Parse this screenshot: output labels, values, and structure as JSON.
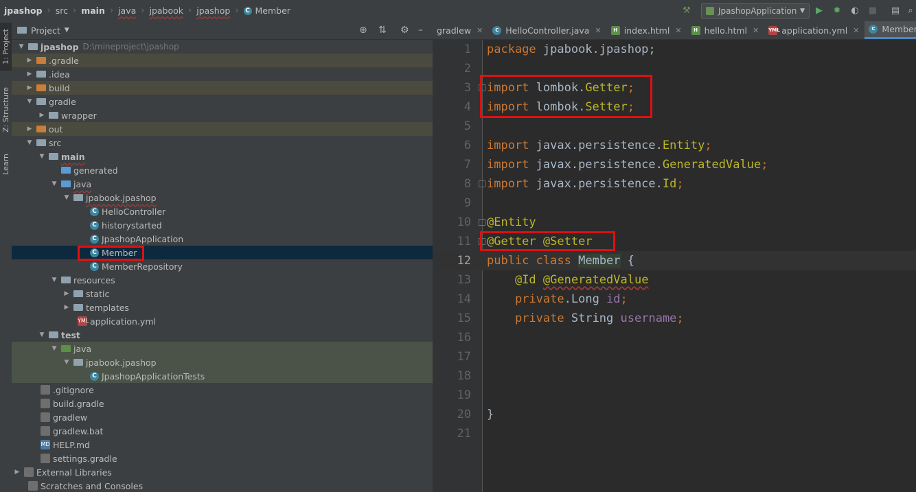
{
  "breadcrumbs": [
    {
      "label": "jpashop"
    },
    {
      "label": "src"
    },
    {
      "label": "main"
    },
    {
      "label": "java"
    },
    {
      "label": "jpabook"
    },
    {
      "label": "jpashop"
    },
    {
      "label": "Member"
    }
  ],
  "run_config": {
    "label": "JpashopApplication"
  },
  "left_tabs": {
    "project": "1: Project",
    "structure": "Z: Structure",
    "learn": "Learn"
  },
  "project_panel": {
    "title": "Project"
  },
  "tree": [
    {
      "label": "jpashop",
      "path": "D:\\mineproject\\jpashop"
    },
    {
      "label": ".gradle"
    },
    {
      "label": ".idea"
    },
    {
      "label": "build"
    },
    {
      "label": "gradle"
    },
    {
      "label": "wrapper"
    },
    {
      "label": "out"
    },
    {
      "label": "src"
    },
    {
      "label": "main"
    },
    {
      "label": "generated"
    },
    {
      "label": "java"
    },
    {
      "label": "jpabook.jpashop"
    },
    {
      "label": "HelloController"
    },
    {
      "label": "historystarted"
    },
    {
      "label": "JpashopApplication"
    },
    {
      "label": "Member"
    },
    {
      "label": "MemberRepository"
    },
    {
      "label": "resources"
    },
    {
      "label": "static"
    },
    {
      "label": "templates"
    },
    {
      "label": "application.yml"
    },
    {
      "label": "test"
    },
    {
      "label": "java"
    },
    {
      "label": "jpabook.jpashop"
    },
    {
      "label": "JpashopApplicationTests"
    },
    {
      "label": ".gitignore"
    },
    {
      "label": "build.gradle"
    },
    {
      "label": "gradlew"
    },
    {
      "label": "gradlew.bat"
    },
    {
      "label": "HELP.md"
    },
    {
      "label": "settings.gradle"
    },
    {
      "label": "External Libraries"
    },
    {
      "label": "Scratches and Consoles"
    }
  ],
  "tabs": [
    {
      "label": "gradlew"
    },
    {
      "label": "HelloController.java"
    },
    {
      "label": "index.html"
    },
    {
      "label": "hello.html"
    },
    {
      "label": "application.yml"
    },
    {
      "label": "Member.java"
    }
  ],
  "code": {
    "line_numbers": [
      "1",
      "2",
      "3",
      "4",
      "5",
      "6",
      "7",
      "8",
      "9",
      "10",
      "11",
      "12",
      "13",
      "14",
      "15",
      "16",
      "17",
      "18",
      "19",
      "20",
      "21"
    ],
    "l1_kw": "package",
    "l1_rest": " jpabook.jpashop;",
    "l3_kw": "import",
    "l3_pkg": " lombok.",
    "l3_cls": "Getter",
    "l3_end": ";",
    "l4_kw": "import",
    "l4_pkg": " lombok.",
    "l4_cls": "Setter",
    "l4_end": ";",
    "l6_kw": "import",
    "l6_pkg": " javax.persistence.",
    "l6_cls": "Entity",
    "l6_end": ";",
    "l7_kw": "import",
    "l7_pkg": " javax.persistence.",
    "l7_cls": "GeneratedValue",
    "l7_end": ";",
    "l8_kw": "import",
    "l8_pkg": " javax.persistence.",
    "l8_cls": "Id",
    "l8_end": ";",
    "l10_ann": "@Entity",
    "l11_ann1": "@Getter",
    "l11_ann2": "@Setter",
    "l12_kw1": "public",
    "l12_kw2": "class",
    "l12_name": "Member",
    "l12_brace": " {",
    "l13_ann1": "@Id",
    "l13_ann2": "@GeneratedValue",
    "l14_kw": "private",
    "l14_dot": ".",
    "l14_type": "Long",
    "l14_field": "id",
    "l14_end": ";",
    "l15_kw": "private",
    "l15_type": "String",
    "l15_field": "username",
    "l15_end": ";",
    "l20_brace": "}"
  },
  "colors": {
    "keyword": "#cc7832",
    "annotation": "#bbb529",
    "field": "#9876aa",
    "highlight": "#e01010"
  }
}
